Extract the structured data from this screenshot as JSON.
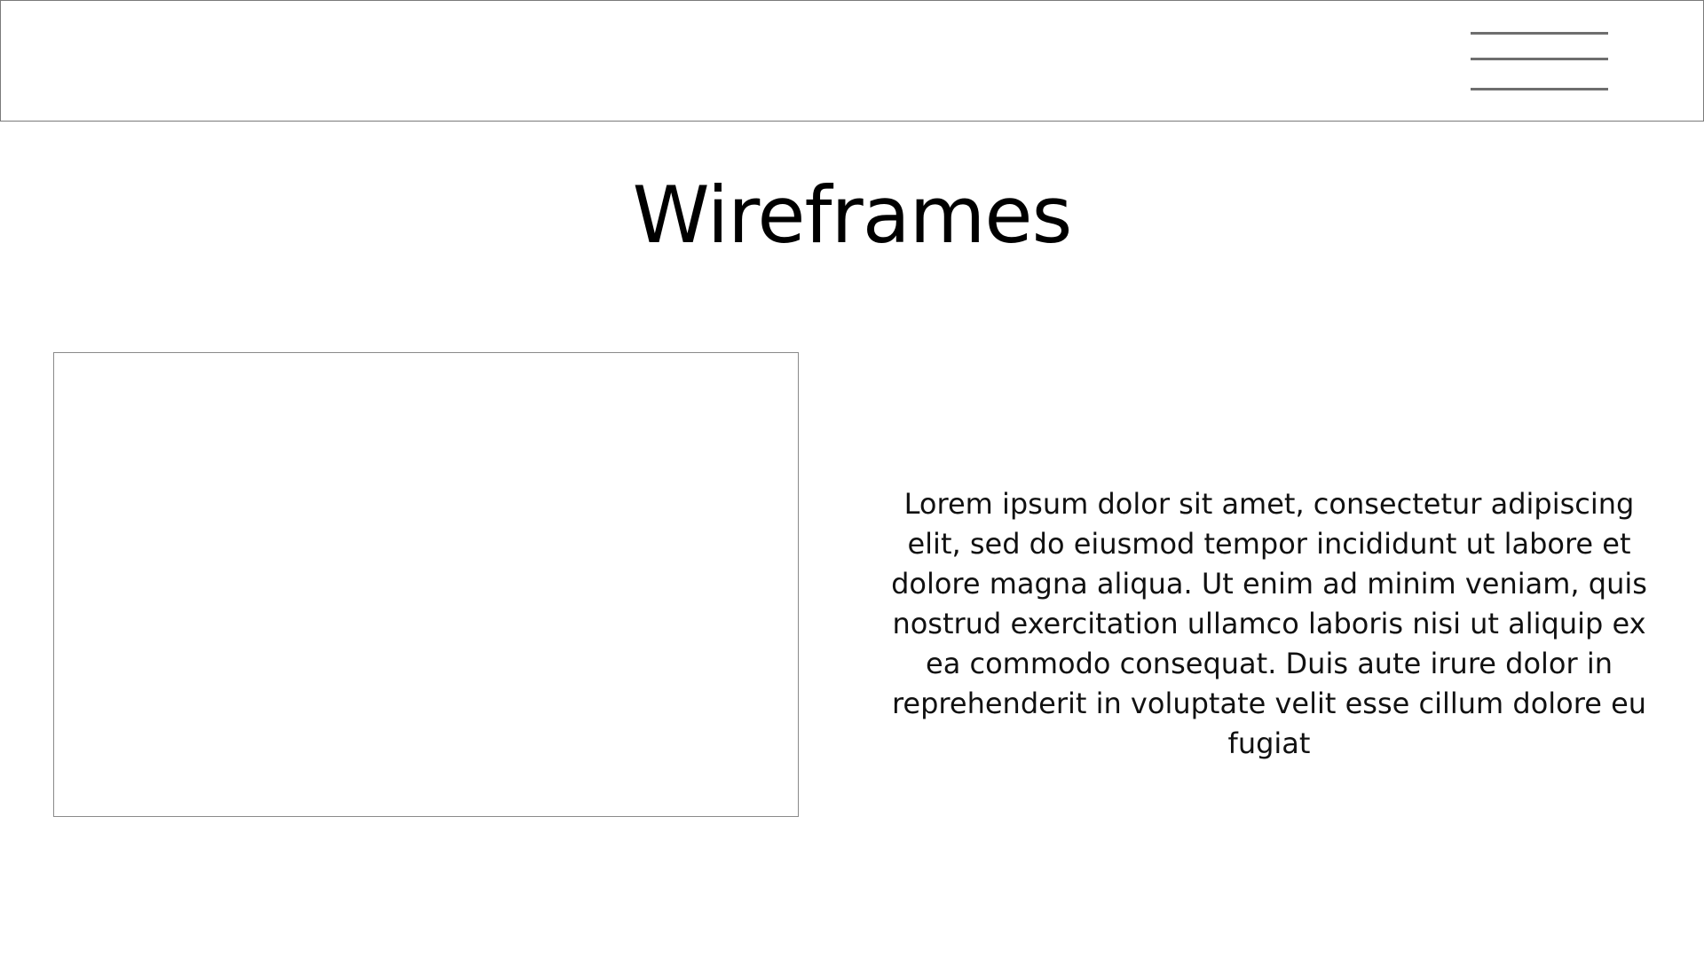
{
  "header": {
    "menu_icon": "hamburger-menu-icon",
    "border_color": "#7a7a7a"
  },
  "main": {
    "title": "Wireframes",
    "image_placeholder": {
      "border_color": "#8a8a8a"
    },
    "body_text": "Lorem ipsum dolor sit amet, consectetur adipiscing elit, sed do eiusmod tempor incididunt ut labore et dolore magna aliqua. Ut enim ad minim veniam, quis nostrud exercitation ullamco laboris nisi ut aliquip ex ea commodo consequat. Duis aute irure dolor in reprehenderit in voluptate velit esse cillum dolore eu fugiat"
  }
}
